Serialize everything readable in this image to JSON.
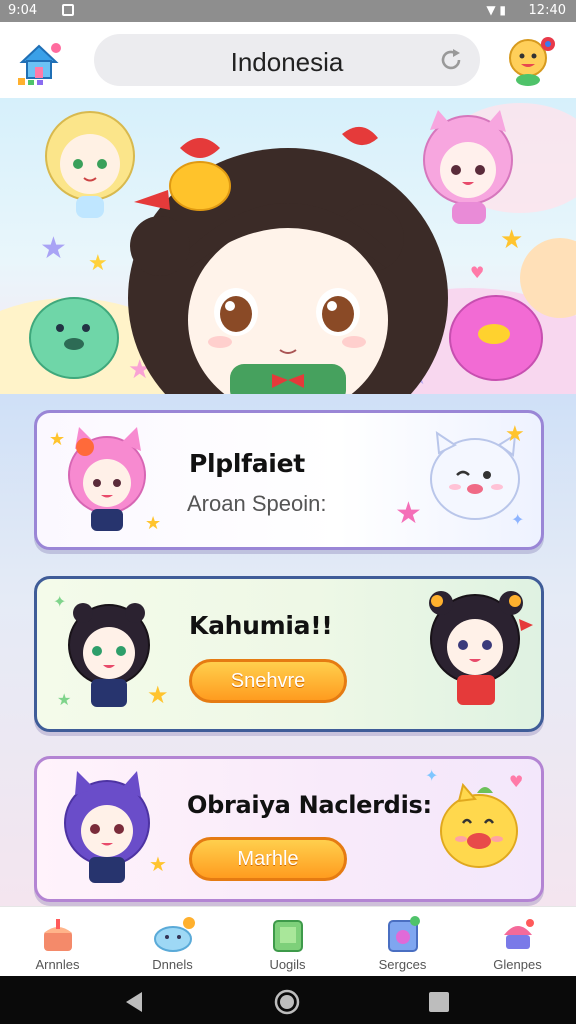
{
  "status_bar": {
    "time_left": "9:04",
    "time_right": "12:40"
  },
  "header": {
    "search_value": "Indonesia"
  },
  "cards": [
    {
      "title": "Plplfaiet",
      "subtitle": "Aroan Speoin:"
    },
    {
      "title": "Kahumia!!",
      "button_label": "Snehvre"
    },
    {
      "title": "Obraiya Naclerdis:",
      "button_label": "Marhle"
    }
  ],
  "bottom_nav": {
    "items": [
      {
        "label": "Arnnles",
        "icon": "cake-icon"
      },
      {
        "label": "Dnnels",
        "icon": "cloud-icon"
      },
      {
        "label": "Uogils",
        "icon": "gift-box-icon"
      },
      {
        "label": "Sergces",
        "icon": "game-card-icon"
      },
      {
        "label": "Glenpes",
        "icon": "cupcake-icon"
      }
    ]
  },
  "colors": {
    "accent_orange": "#ff9c1f",
    "card_border_purple": "#7b6bc4",
    "card_border_navy": "#3f5c98"
  }
}
